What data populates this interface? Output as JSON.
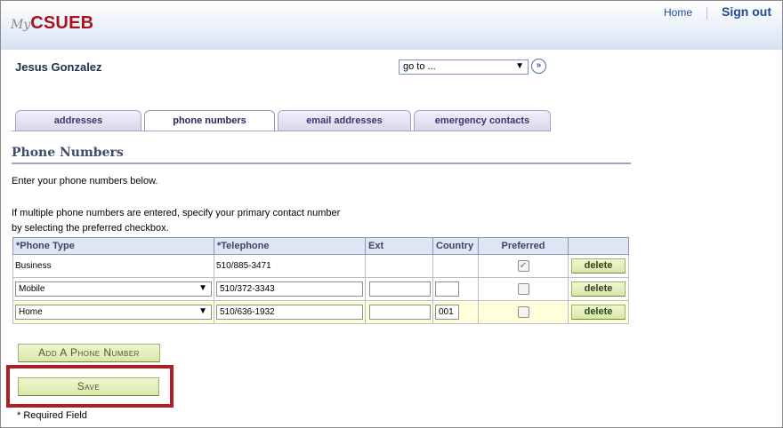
{
  "header": {
    "logo_prefix": "My",
    "logo_main": "CSUEB",
    "home_link": "Home",
    "signout_link": "Sign out"
  },
  "user": {
    "name": "Jesus Gonzalez"
  },
  "goto_select": {
    "value": "go to ...",
    "go_symbol": "»"
  },
  "tabs": [
    {
      "label": "addresses",
      "active": false
    },
    {
      "label": "phone numbers",
      "active": true
    },
    {
      "label": "email addresses",
      "active": false
    },
    {
      "label": "emergency contacts",
      "active": false
    }
  ],
  "section": {
    "title": "Phone Numbers",
    "intro": "Enter your phone numbers below.",
    "multiple_line1": "If multiple phone numbers are entered, specify your primary contact number",
    "multiple_line2": "by selecting the preferred checkbox."
  },
  "table": {
    "headers": [
      "*Phone Type",
      "*Telephone",
      "Ext",
      "Country",
      "Preferred",
      ""
    ],
    "rows": [
      {
        "type": "Business",
        "telephone": "510/885-3471",
        "ext": "",
        "country": "",
        "preferred": true,
        "delete_label": "delete"
      },
      {
        "type": "Mobile",
        "telephone": "510/372-3343",
        "ext": "",
        "country": "",
        "preferred": false,
        "delete_label": "delete"
      },
      {
        "type": "Home",
        "telephone": "510/636-1932",
        "ext": "",
        "country": "001",
        "preferred": false,
        "delete_label": "delete"
      }
    ]
  },
  "buttons": {
    "add": "Add A Phone Number",
    "save": "Save"
  },
  "footer": {
    "required_note": "* Required Field"
  },
  "icons": {
    "check": "✔",
    "caret": "▼"
  },
  "colors": {
    "brand_red": "#a8141e",
    "link_blue": "#1f4a92",
    "highlight_red": "#b01e24",
    "button_green": "#d7e8a8"
  }
}
